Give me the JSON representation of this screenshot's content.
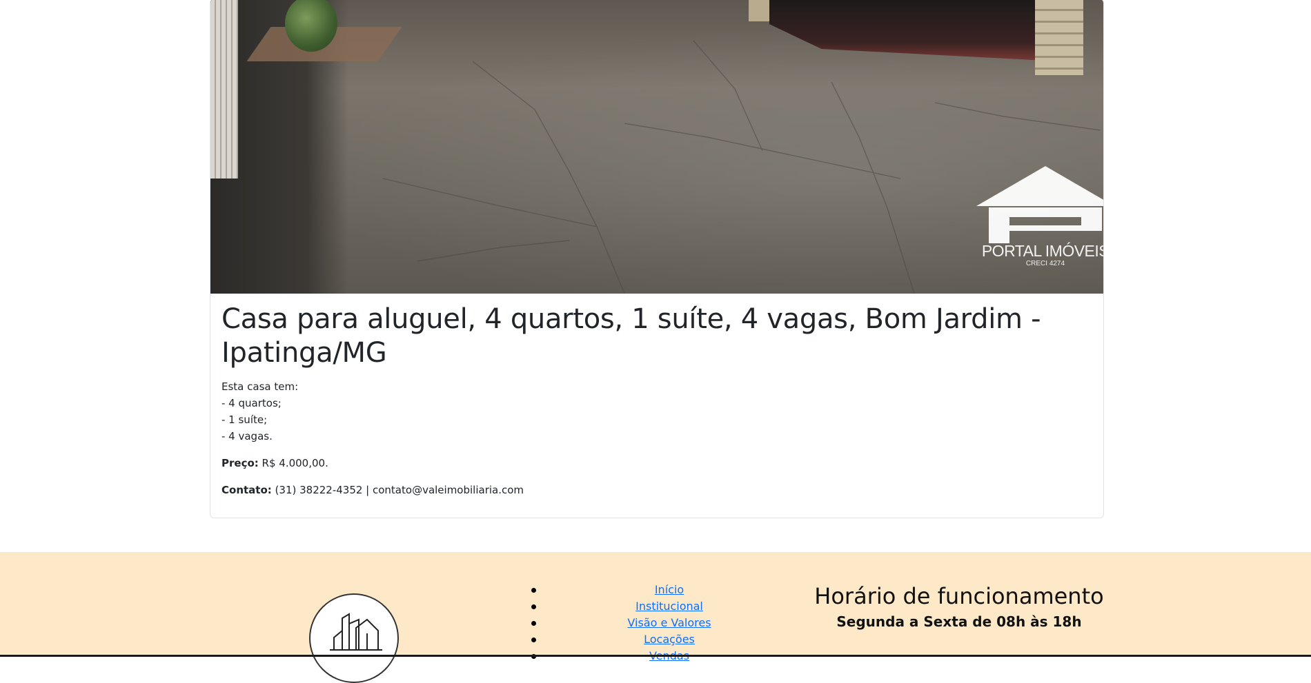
{
  "listing": {
    "photo": {
      "alt": "Quintal com piso de cimento e garagem",
      "watermark": {
        "name": "PORTAL IMÓVEIS",
        "registration": "CRECI 4274"
      }
    },
    "title": "Casa para aluguel, 4 quartos, 1 suíte, 4 vagas, Bom Jardim - Ipatinga/MG",
    "description_lines": [
      "Esta casa tem:",
      "- 4 quartos;",
      "- 1 suíte;",
      "- 4 vagas."
    ],
    "price_label": "Preço:",
    "price_value": "R$ 4.000,00.",
    "contact_label": "Contato:",
    "contact_value": "(31) 38222-4352 | contato@valeimobiliaria.com"
  },
  "footer": {
    "background": "#fde9c8",
    "nav_items": [
      "Início",
      "Institucional",
      "Visão e Valores",
      "Locações",
      "Vendas"
    ],
    "hours_title": "Horário de funcionamento",
    "hours_text": "Segunda a Sexta de 08h às 18h"
  },
  "colors": {
    "link": "#0d6efd",
    "text": "#212529"
  }
}
